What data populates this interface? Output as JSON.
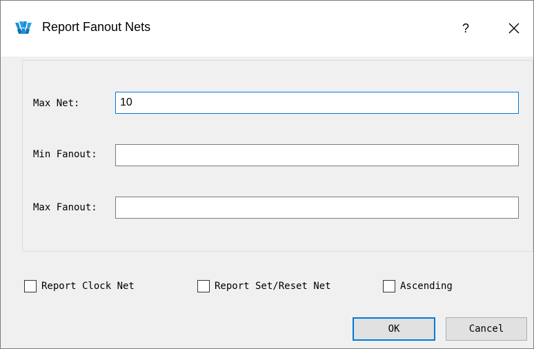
{
  "window": {
    "title": "Report Fanout Nets",
    "help_label": "?",
    "icon": "app-logo-icon",
    "close_icon": "close-icon"
  },
  "form": {
    "max_net": {
      "label": "Max Net:",
      "value": "10"
    },
    "min_fanout": {
      "label": "Min Fanout:",
      "value": ""
    },
    "max_fanout": {
      "label": "Max Fanout:",
      "value": ""
    }
  },
  "options": {
    "report_clock_net": {
      "label": "Report Clock Net",
      "checked": false
    },
    "report_set_reset_net": {
      "label": "Report Set/Reset Net",
      "checked": false
    },
    "ascending": {
      "label": "Ascending",
      "checked": false
    }
  },
  "buttons": {
    "ok": "OK",
    "cancel": "Cancel"
  },
  "colors": {
    "accent": "#0078d7",
    "logo": "#1a8fd6"
  }
}
